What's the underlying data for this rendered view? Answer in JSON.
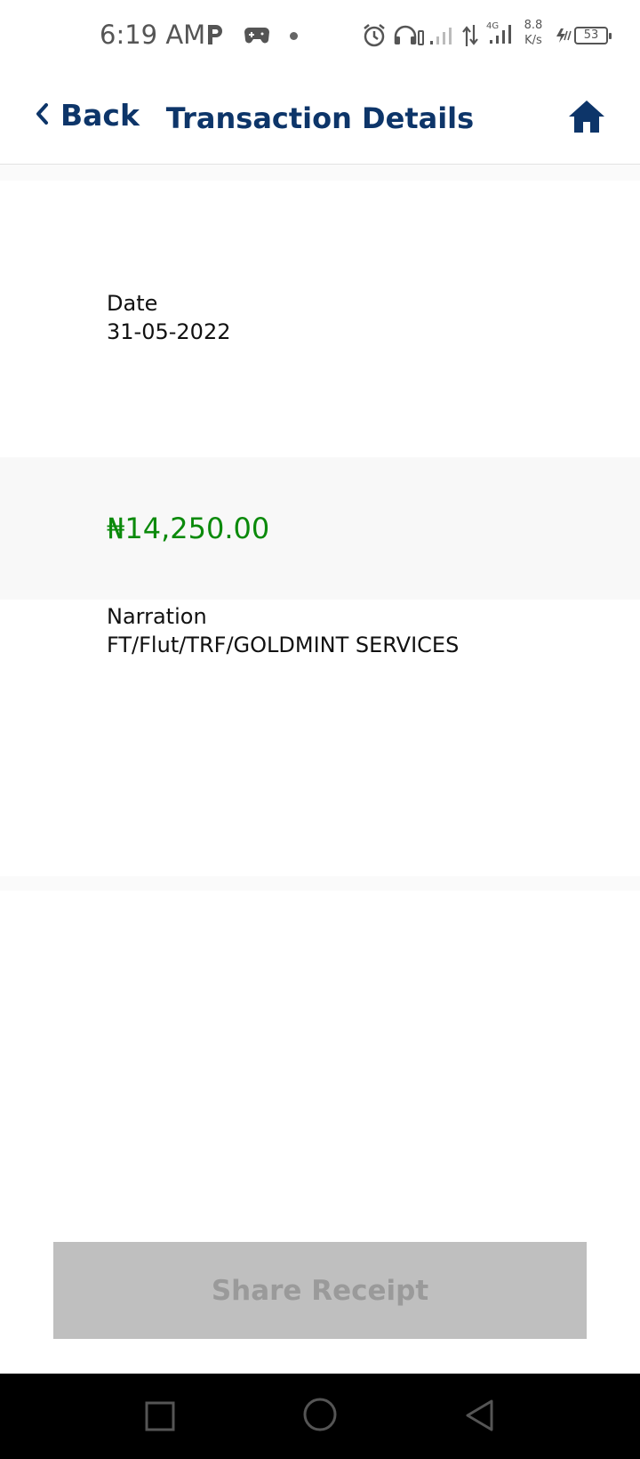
{
  "status_bar": {
    "time": "6:19 AM",
    "net_speed_value": "8.8",
    "net_speed_unit": "K/s",
    "network_type": "4G",
    "battery": "53",
    "icons": [
      "parking-icon",
      "game-icon",
      "notification-dot",
      "alarm-icon",
      "headphones-icon",
      "signal-icon",
      "data-arrows-icon",
      "signal-4g-icon",
      "charging-icon",
      "battery-icon"
    ]
  },
  "header": {
    "back_label": "Back",
    "title": "Transaction Details",
    "icons": [
      "chevron-left-icon",
      "home-icon"
    ],
    "accent_color": "#0d3569"
  },
  "transaction": {
    "date_label": "Date",
    "date_value": "31-05-2022",
    "amount": "₦14,250.00",
    "amount_color": "#0b8a0b",
    "narration_label": "Narration",
    "narration_value": "FT/Flut/TRF/GOLDMINT SERVICES"
  },
  "actions": {
    "share_label": "Share Receipt"
  },
  "nav_bar": {
    "icons": [
      "recents-square-icon",
      "home-circle-icon",
      "back-triangle-icon"
    ]
  }
}
